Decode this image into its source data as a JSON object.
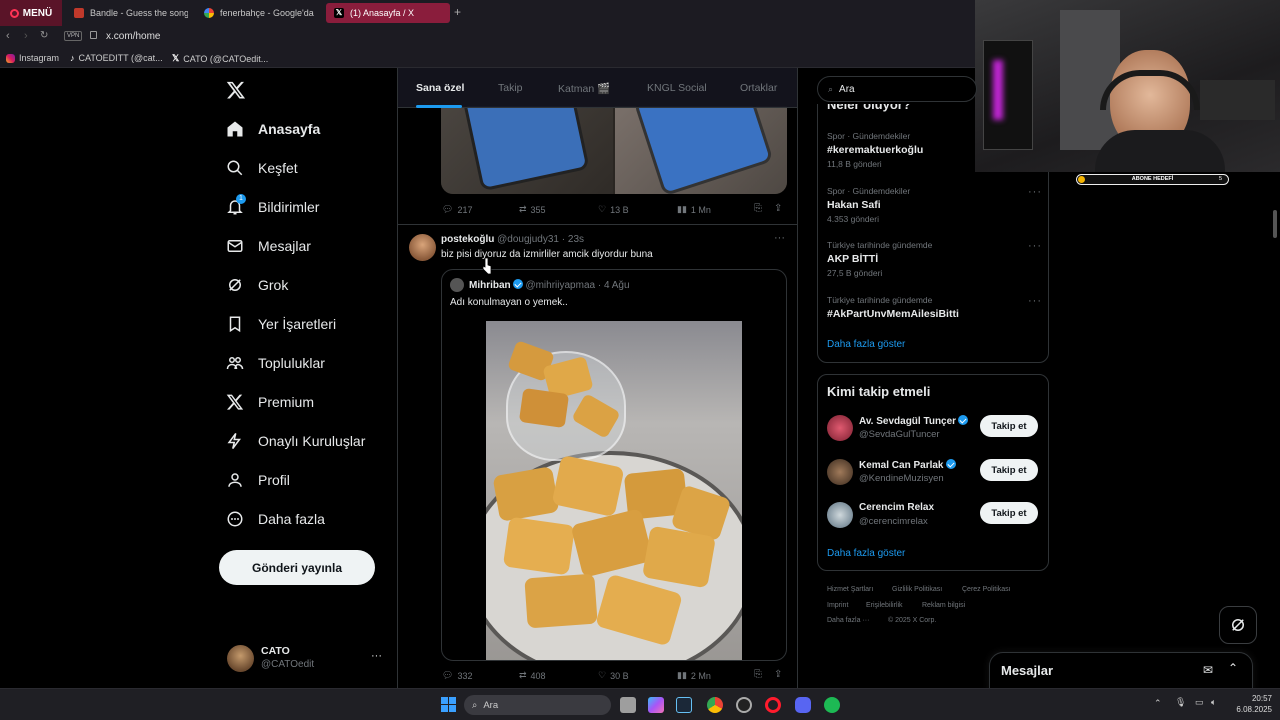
{
  "browser": {
    "menu_label": "MENÜ",
    "tabs": [
      {
        "label": "Bandle - Guess the song"
      },
      {
        "label": "fenerbahçe - Google'da"
      },
      {
        "label": "(1) Anasayfa / X"
      }
    ],
    "new_tab": "+",
    "vpn_badge": "VPN",
    "url": "x.com/home",
    "bookmarks": [
      {
        "label": "Instagram"
      },
      {
        "label": "CATOEDITT (@cat..."
      },
      {
        "label": "CATO (@CATOedit..."
      }
    ]
  },
  "sidebar": {
    "items": [
      {
        "label": "Anasayfa",
        "icon": "home-icon"
      },
      {
        "label": "Keşfet",
        "icon": "search-icon"
      },
      {
        "label": "Bildirimler",
        "icon": "bell-icon",
        "badge": "1"
      },
      {
        "label": "Mesajlar",
        "icon": "mail-icon"
      },
      {
        "label": "Grok",
        "icon": "grok-icon"
      },
      {
        "label": "Yer İşaretleri",
        "icon": "bookmark-icon"
      },
      {
        "label": "Topluluklar",
        "icon": "people-icon"
      },
      {
        "label": "Premium",
        "icon": "x-logo-icon"
      },
      {
        "label": "Onaylı Kuruluşlar",
        "icon": "lightning-icon"
      },
      {
        "label": "Profil",
        "icon": "person-icon"
      },
      {
        "label": "Daha fazla",
        "icon": "more-circle-icon"
      }
    ],
    "post_button": "Gönderi yayınla",
    "account": {
      "name": "CATO",
      "handle": "@CATOedit",
      "more": "···"
    }
  },
  "timeline": {
    "tabs": [
      "Sana özel",
      "Takip",
      "Katman 🎬",
      "KNGL Social",
      "Ortaklar"
    ],
    "top_post_actions": {
      "replies": "217",
      "reposts": "355",
      "likes": "13 B",
      "views": "1 Mn"
    },
    "post": {
      "author": "postekoğlu",
      "handle": "@dougjudy31",
      "time": "· 23s",
      "more": "···",
      "text": "biz pisi diyoruz da izmirliler amcik diyordur buna",
      "quote": {
        "author": "Mihriban",
        "handle": "@mihriiyapmaa",
        "date": "· 4 Ağu",
        "text": "Adı konulmayan o yemek.."
      },
      "actions": {
        "replies": "332",
        "reposts": "408",
        "likes": "30 B",
        "views": "2 Mn"
      }
    }
  },
  "right": {
    "search_placeholder": "Ara",
    "trends_title": "Neler oluyor?",
    "trends": [
      {
        "context": "Spor · Gündemdekiler",
        "name": "#keremaktuerkoğlu",
        "count": "11,8 B gönderi"
      },
      {
        "context": "Spor · Gündemdekiler",
        "name": "Hakan Safi",
        "count": "4.353 gönderi"
      },
      {
        "context": "Türkiye tarihinde gündemde",
        "name": "AKP BİTTİ",
        "count": "27,5 B gönderi"
      },
      {
        "context": "Türkiye tarihinde gündemde",
        "name": "#AkPartUnvMemAilesiBitti",
        "count": ""
      }
    ],
    "trends_more": "Daha fazla göster",
    "follow_title": "Kimi takip etmeli",
    "follow": [
      {
        "name": "Av. Sevdagül Tunçer",
        "handle": "@SevdaGulTuncer",
        "button": "Takip et",
        "verified": true
      },
      {
        "name": "Kemal Can Parlak",
        "handle": "@KendineMuzisyen",
        "button": "Takip et",
        "verified": true
      },
      {
        "name": "Cerencim Relax",
        "handle": "@cerencimrelax",
        "button": "Takip et",
        "verified": false
      }
    ],
    "follow_more": "Daha fazla göster",
    "footer": [
      "Hizmet Şartları",
      "Gizlilik Politikası",
      "Çerez Politikası",
      "Imprint",
      "Erişilebilirlik",
      "Reklam bilgisi",
      "Daha fazla ···",
      "© 2025 X Corp."
    ]
  },
  "messages_drawer": {
    "title": "Mesajlar"
  },
  "stream_overlay": {
    "bar_label": "ABONE HEDEFİ",
    "bar_value": "5"
  },
  "taskbar": {
    "search_placeholder": "Ara",
    "time": "20:57",
    "date": "6.08.2025"
  },
  "colors": {
    "accent": "#1d9bf0",
    "background": "#000000",
    "border": "#2f3336",
    "active_tab": "#8a1d3c"
  }
}
